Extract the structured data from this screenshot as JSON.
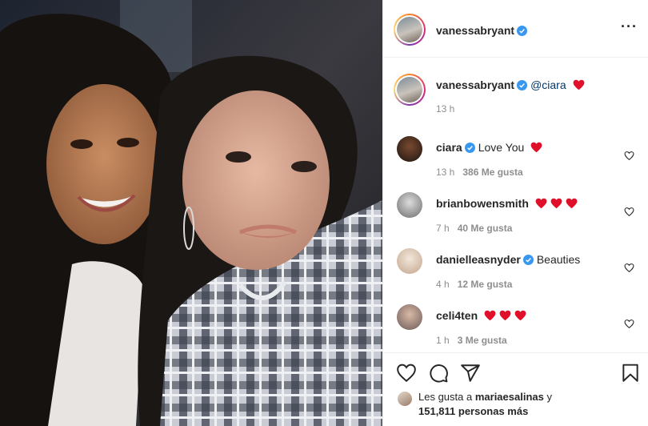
{
  "post": {
    "author": "vanessabryant",
    "more_icon": "more-horizontal-icon",
    "caption_mention": "@ciara",
    "caption_emoji": "red-heart",
    "caption_time": "13 h"
  },
  "comments": [
    {
      "user": "ciara",
      "verified": true,
      "text": "Love You",
      "hearts": 1,
      "time": "13 h",
      "likes": "386 Me gusta"
    },
    {
      "user": "brianbowensmith",
      "verified": false,
      "text": "",
      "hearts": 3,
      "time": "7 h",
      "likes": "40 Me gusta"
    },
    {
      "user": "danielleasnyder",
      "verified": true,
      "text": "Beauties",
      "hearts": 0,
      "time": "4 h",
      "likes": "12 Me gusta"
    },
    {
      "user": "celi4ten",
      "verified": false,
      "text": "",
      "hearts": 3,
      "time": "1 h",
      "likes": "3 Me gusta"
    }
  ],
  "actions": {
    "icons": [
      "heart-icon",
      "comment-icon",
      "share-icon",
      "bookmark-icon"
    ],
    "liked_prefix": "Les gusta a",
    "liked_user": "mariaesalinas",
    "liked_and": "y",
    "liked_count": "151,811 personas más"
  },
  "colors": {
    "verified": "#3897f0",
    "heart": "#ed4956",
    "link": "#00376b",
    "muted": "#8e8e8e"
  }
}
